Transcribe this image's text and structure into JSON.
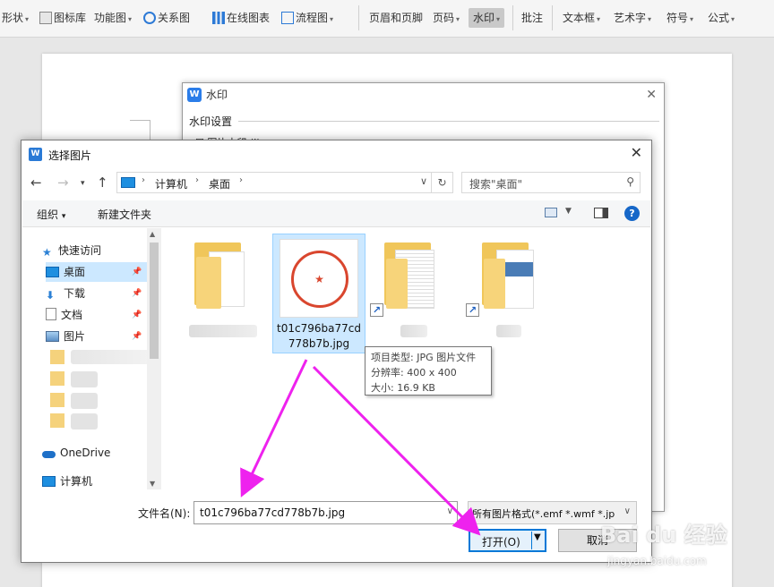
{
  "ribbon": {
    "items": [
      {
        "label": "形状",
        "dropdown": true
      },
      {
        "label": "图标库",
        "dropdown": false
      },
      {
        "label": "功能图",
        "dropdown": true
      },
      {
        "label": "关系图",
        "dropdown": false
      },
      {
        "label": "在线图表",
        "dropdown": false
      },
      {
        "label": "流程图",
        "dropdown": true
      },
      {
        "label": "页眉和页脚",
        "dropdown": false
      },
      {
        "label": "页码",
        "dropdown": true
      },
      {
        "label": "水印",
        "dropdown": true
      },
      {
        "label": "批注",
        "dropdown": false
      },
      {
        "label": "文本框",
        "dropdown": true
      },
      {
        "label": "艺术字",
        "dropdown": true
      },
      {
        "label": "符号",
        "dropdown": true
      },
      {
        "label": "公式",
        "dropdown": true
      }
    ],
    "active": "水印"
  },
  "watermark_dialog": {
    "title": "水印",
    "logo": "W",
    "section": "水印设置",
    "checkbox_label": "图片水印 (I)"
  },
  "file_dialog": {
    "title": "选择图片",
    "address": [
      "计算机",
      "桌面"
    ],
    "search_placeholder": "搜索\"桌面\"",
    "toolbar": {
      "organize": "组织",
      "new_folder": "新建文件夹"
    },
    "nav": {
      "quick_access": "快速访问",
      "desktop": "桌面",
      "downloads": "下载",
      "documents": "文档",
      "pictures": "图片",
      "onedrive": "OneDrive",
      "computer": "计算机"
    },
    "selected_file": {
      "name_line1": "t01c796ba77cd",
      "name_line2": "778b7b.jpg"
    },
    "tooltip": {
      "type": "项目类型: JPG 图片文件",
      "resolution": "分辨率: 400 x 400",
      "size": "大小: 16.9 KB"
    },
    "filename_label": "文件名(N):",
    "filename_value": "t01c796ba77cd778b7b.jpg",
    "filetype_value": "所有图片格式(*.emf *.wmf *.jp",
    "open_button": "打开(O)",
    "cancel_button": "取消"
  },
  "colors": {
    "accent": "#0078d7",
    "annotation_arrow": "#ee22ee",
    "stamp": "#d9462e"
  }
}
